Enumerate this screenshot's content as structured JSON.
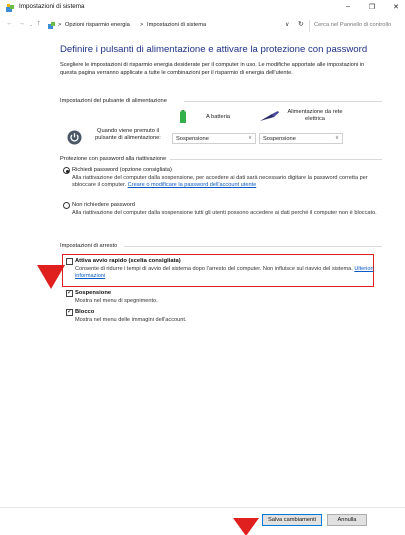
{
  "window": {
    "title": "Impostazioni di sistema",
    "minimize": "–",
    "maximize": "❐",
    "close": "✕"
  },
  "address": {
    "back": "←",
    "forward": "→",
    "history": "⌄",
    "up": "↑",
    "crumb_1": "Opzioni risparmio energia",
    "separator": ">",
    "crumb_2": "Impostazioni di sistema",
    "dropdown": "∨",
    "refresh": "↻",
    "search_placeholder": "Cerca nel Pannello di controllo"
  },
  "page": {
    "title": "Definire i pulsanti di alimentazione e attivare la protezione con password",
    "intro": "Scegliere le impostazioni di risparmio energia desiderate per il computer in uso. Le modifiche apportate alle impostazioni in questa pagina verranno applicate a tutte le combinazioni per il risparmio di energia dell'utente."
  },
  "power_buttons": {
    "section": "Impostazioni del pulsante di alimentazione",
    "battery_label": "A batteria",
    "ac_label": "Alimentazione da rete elettrica",
    "row_label": "Quando viene premuto il pulsante di alimentazione:",
    "battery_value": "Sospensione",
    "ac_value": "Sospensione",
    "arrow": "∨"
  },
  "password": {
    "section": "Protezione con password alla riattivazione",
    "option_1": "Richiedi password (opzione consigliata)",
    "option_1_desc": "Alla riattivazione del computer dalla sospensione, per accedere ai dati sarà necessario digitare la password corretta per sbloccare il computer.",
    "option_1_link": "Creare o modificare la password dell'account utente",
    "option_2": "Non richiedere password",
    "option_2_desc": "Alla riattivazione del computer dalla sospensione tutti gli utenti possono accedere ai dati perché il computer non è bloccato.",
    "selected": "option_1"
  },
  "shutdown": {
    "section": "Impostazioni di arresto",
    "fast_title": "Attiva avvio rapido (scelta consigliata)",
    "fast_desc": "Consente di ridurre i tempi di avvio del sistema dopo l'arresto del computer. Non influisce sul riavvio del sistema.",
    "fast_link": "Ulteriori informazioni",
    "fast_checked": false,
    "sleep_title": "Sospensione",
    "sleep_desc": "Mostra nel menu di spegnimento.",
    "sleep_checked": true,
    "lock_title": "Blocco",
    "lock_desc": "Mostra nel menu delle immagini dell'account.",
    "lock_checked": true,
    "check_mark": "✓"
  },
  "footer": {
    "save": "Salva cambiamenti",
    "cancel": "Annulla"
  },
  "colors": {
    "title_blue": "#1e3287",
    "link_blue": "#0a5bc4",
    "highlight_red": "#e0201f"
  }
}
